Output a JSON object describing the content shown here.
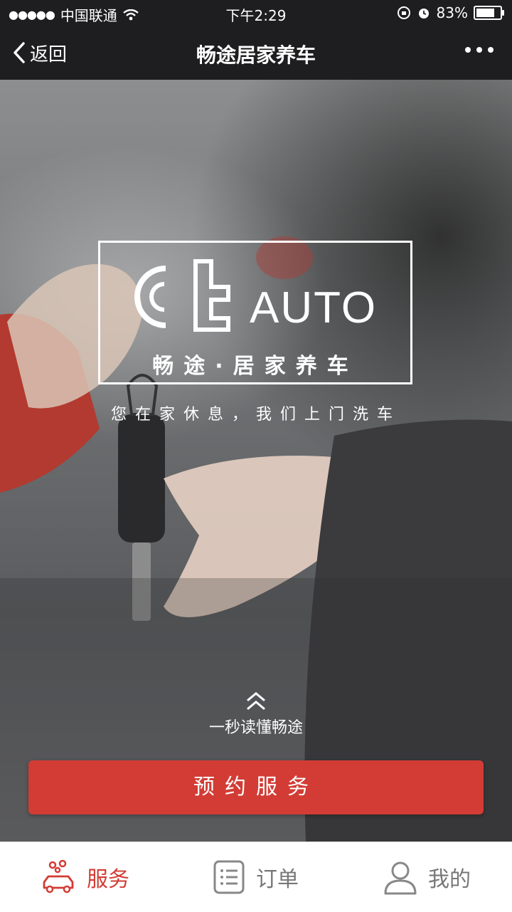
{
  "status_bar": {
    "carrier": "中国联通",
    "time": "下午2:29",
    "battery": "83%",
    "battery_level": 0.83
  },
  "nav": {
    "back_label": "返回",
    "title": "畅途居家养车"
  },
  "hero": {
    "logo_text": "AUTO",
    "logo_name": "畅途·居家养车",
    "slogan": "您在家休息，我们上门洗车",
    "learn_more": "一秒读懂畅途",
    "book_button": "预约服务"
  },
  "tabs": [
    {
      "label": "服务",
      "icon": "car-service-icon",
      "active": true
    },
    {
      "label": "订单",
      "icon": "list-icon",
      "active": false
    },
    {
      "label": "我的",
      "icon": "user-icon",
      "active": false
    }
  ],
  "colors": {
    "accent": "#d23c35",
    "bar_bg": "#1e1e20"
  }
}
